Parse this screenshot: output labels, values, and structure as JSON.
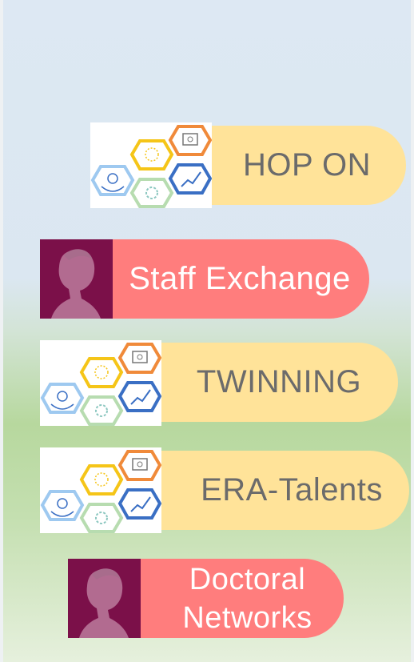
{
  "programs": [
    {
      "label": "HOP ON",
      "style": "yellow",
      "icon": "hexagon-cluster-icon"
    },
    {
      "label": "Staff Exchange",
      "style": "red",
      "icon": "portrait-icon"
    },
    {
      "label": "TWINNING",
      "style": "yellow",
      "icon": "hexagon-cluster-icon"
    },
    {
      "label": "ERA-Talents",
      "style": "yellow",
      "icon": "hexagon-cluster-icon"
    },
    {
      "label_line1": "Doctoral",
      "label_line2": "Networks",
      "style": "red",
      "icon": "portrait-icon"
    }
  ],
  "colors": {
    "yellow_pill": "#ffe399",
    "red_pill": "#ff7d7d",
    "portrait_bg": "#7b1049",
    "hex_orange": "#f08a3a",
    "hex_yellow": "#f5c518",
    "hex_blue": "#3a6fc4",
    "hex_lightblue": "#9ec9f0",
    "hex_green": "#b7dcb0"
  }
}
